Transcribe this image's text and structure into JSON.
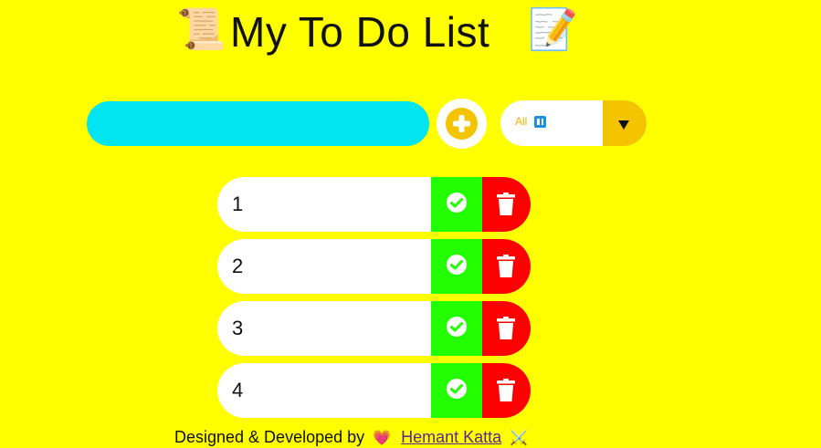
{
  "header": {
    "title": "My To Do List",
    "left_emoji": "📜",
    "right_emoji": "📝"
  },
  "input": {
    "value": "",
    "placeholder": ""
  },
  "add_button": {
    "icon": "plus-circle-icon",
    "color": "#f5c400"
  },
  "filter": {
    "selected": "All",
    "icon": "filter-icon"
  },
  "todos": [
    {
      "text": "1"
    },
    {
      "text": "2"
    },
    {
      "text": "3"
    },
    {
      "text": "4"
    }
  ],
  "buttons": {
    "complete_icon": "check-circle-icon",
    "delete_icon": "trash-icon"
  },
  "footer": {
    "prefix": "Designed & Developed by",
    "heart": "💗",
    "author": "Hemant Katta",
    "sword": "⚔️"
  },
  "colors": {
    "background": "#ffff00",
    "input_bg": "#00e5f0",
    "complete_btn": "#22ff00",
    "delete_btn": "#ff0000",
    "filter_arrow_bg": "#f5c400"
  }
}
